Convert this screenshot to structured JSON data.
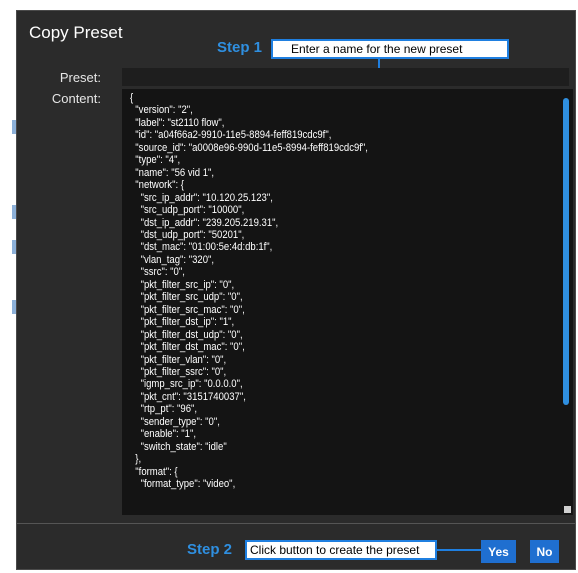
{
  "dialog": {
    "title": "Copy Preset",
    "preset_label": "Preset:",
    "content_label": "Content:",
    "preset_value": "",
    "content_text": "{\n  \"version\": \"2\",\n  \"label\": \"st2110 flow\",\n  \"id\": \"a04f66a2-9910-11e5-8894-feff819cdc9f\",\n  \"source_id\": \"a0008e96-990d-11e5-8994-feff819cdc9f\",\n  \"type\": \"4\",\n  \"name\": \"56 vid 1\",\n  \"network\": {\n    \"src_ip_addr\": \"10.120.25.123\",\n    \"src_udp_port\": \"10000\",\n    \"dst_ip_addr\": \"239.205.219.31\",\n    \"dst_udp_port\": \"50201\",\n    \"dst_mac\": \"01:00:5e:4d:db:1f\",\n    \"vlan_tag\": \"320\",\n    \"ssrc\": \"0\",\n    \"pkt_filter_src_ip\": \"0\",\n    \"pkt_filter_src_udp\": \"0\",\n    \"pkt_filter_src_mac\": \"0\",\n    \"pkt_filter_dst_ip\": \"1\",\n    \"pkt_filter_dst_udp\": \"0\",\n    \"pkt_filter_dst_mac\": \"0\",\n    \"pkt_filter_vlan\": \"0\",\n    \"pkt_filter_ssrc\": \"0\",\n    \"igmp_src_ip\": \"0.0.0.0\",\n    \"pkt_cnt\": \"3151740037\",\n    \"rtp_pt\": \"96\",\n    \"sender_type\": \"0\",\n    \"enable\": \"1\",\n    \"switch_state\": \"idle\"\n  },\n  \"format\": {\n    \"format_type\": \"video\","
  },
  "annotations": {
    "step1_label": "Step 1",
    "step1_text": "Enter a name for the new preset",
    "step2_label": "Step 2",
    "step2_text": "Click button to create the preset"
  },
  "buttons": {
    "yes": "Yes",
    "no": "No"
  },
  "colors": {
    "dialog_bg": "#2b2b2b",
    "accent": "#1f6fd0",
    "step_label": "#2f8fe0"
  }
}
